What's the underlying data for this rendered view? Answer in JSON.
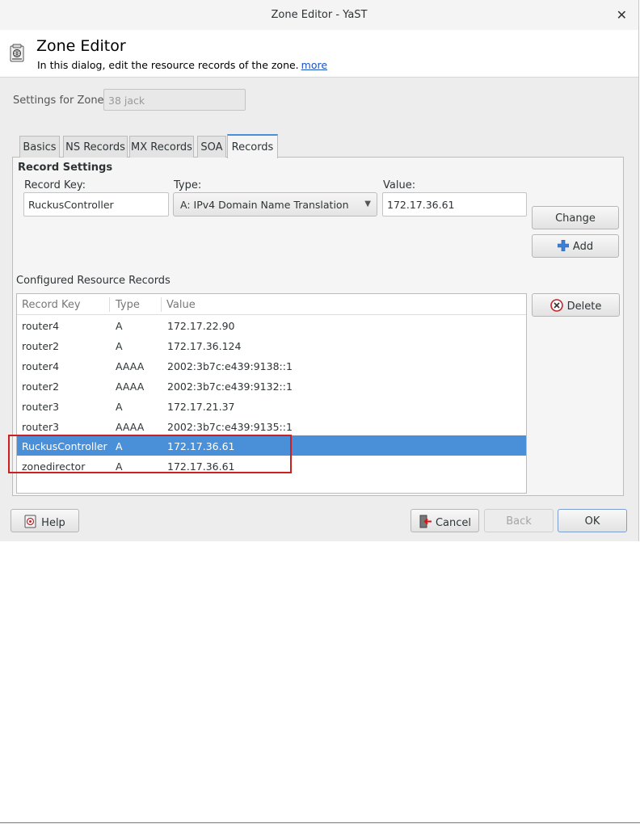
{
  "window": {
    "title": "Zone Editor - YaST"
  },
  "header": {
    "title": "Zone Editor",
    "description": "In this dialog, edit the resource records of the zone.",
    "more_link": "more",
    "icon": "zone-editor-icon"
  },
  "zone": {
    "label": "Settings for Zone",
    "value": "38 jack"
  },
  "tabs": [
    {
      "label": "Basics",
      "active": false
    },
    {
      "label": "NS Records",
      "active": false
    },
    {
      "label": "MX Records",
      "active": false
    },
    {
      "label": "SOA",
      "active": false
    },
    {
      "label": "Records",
      "active": true
    }
  ],
  "record_settings": {
    "title": "Record Settings",
    "key_label": "Record Key:",
    "key_value": "RuckusController",
    "type_label": "Type:",
    "type_value": "A: IPv4 Domain Name Translation",
    "value_label": "Value:",
    "value_value": "172.17.36.61",
    "change_button": "Change",
    "add_button": "Add"
  },
  "records": {
    "title": "Configured Resource Records",
    "columns": [
      "Record Key",
      "Type",
      "Value"
    ],
    "rows": [
      {
        "key": "router4",
        "type": "A",
        "value": "172.17.22.90",
        "selected": false
      },
      {
        "key": "router2",
        "type": "A",
        "value": "172.17.36.124",
        "selected": false
      },
      {
        "key": "router4",
        "type": "AAAA",
        "value": "2002:3b7c:e439:9138::1",
        "selected": false
      },
      {
        "key": "router2",
        "type": "AAAA",
        "value": "2002:3b7c:e439:9132::1",
        "selected": false
      },
      {
        "key": "router3",
        "type": "A",
        "value": "172.17.21.37",
        "selected": false
      },
      {
        "key": "router3",
        "type": "AAAA",
        "value": "2002:3b7c:e439:9135::1",
        "selected": false
      },
      {
        "key": "RuckusController",
        "type": "A",
        "value": "172.17.36.61",
        "selected": true
      },
      {
        "key": "zonedirector",
        "type": "A",
        "value": "172.17.36.61",
        "selected": false
      }
    ],
    "delete_button": "Delete"
  },
  "footer": {
    "help_button": "Help",
    "cancel_button": "Cancel",
    "back_button": "Back",
    "ok_button": "OK"
  },
  "colors": {
    "selection": "#4a90d9",
    "highlight_box": "#cc1f1f",
    "link": "#1a52c4"
  }
}
